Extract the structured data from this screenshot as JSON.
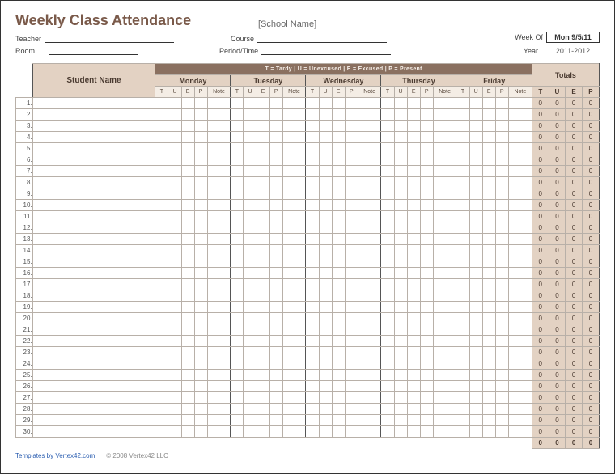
{
  "title": "Weekly Class Attendance",
  "school_placeholder": "[School Name]",
  "fields": {
    "teacher_label": "Teacher",
    "room_label": "Room",
    "course_label": "Course",
    "period_label": "Period/Time",
    "week_of_label": "Week Of",
    "year_label": "Year"
  },
  "week_of": "Mon 9/5/11",
  "year": "2011-2012",
  "legend": "T = Tardy    |    U = Unexcused    |    E = Excused    |    P = Present",
  "headers": {
    "student": "Student Name",
    "totals": "Totals",
    "days": [
      "Monday",
      "Tuesday",
      "Wednesday",
      "Thursday",
      "Friday"
    ],
    "cols": [
      "T",
      "U",
      "E",
      "P",
      "Note"
    ],
    "tot_cols": [
      "T",
      "U",
      "E",
      "P"
    ]
  },
  "row_count": 30,
  "totals_row": {
    "T": 0,
    "U": 0,
    "E": 0,
    "P": 0
  },
  "grand_totals": {
    "T": 0,
    "U": 0,
    "E": 0,
    "P": 0
  },
  "footer": {
    "link_text": "Templates by Vertex42.com",
    "copyright": "© 2008 Vertex42 LLC"
  }
}
